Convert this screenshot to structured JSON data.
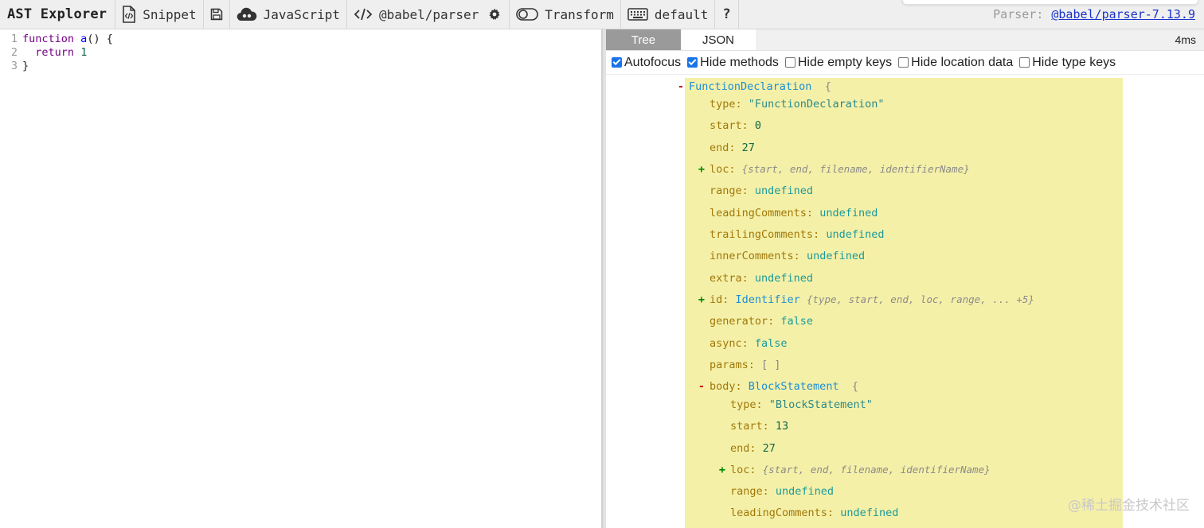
{
  "toolbar": {
    "brand": "AST Explorer",
    "snippet": "Snippet",
    "language": "JavaScript",
    "parser": "@babel/parser",
    "transform": "Transform",
    "keymap": "default",
    "help": "?",
    "parser_label": "Parser:",
    "parser_version": "@babel/parser-7.13.9"
  },
  "editor": {
    "lines": [
      {
        "num": "1",
        "parts": [
          [
            "kw",
            "function"
          ],
          [
            "plain",
            " "
          ],
          [
            "fn",
            "a"
          ],
          [
            "plain",
            "() {"
          ]
        ]
      },
      {
        "num": "2",
        "parts": [
          [
            "plain",
            "  "
          ],
          [
            "kw",
            "return"
          ],
          [
            "plain",
            " "
          ],
          [
            "num",
            "1"
          ]
        ]
      },
      {
        "num": "3",
        "parts": [
          [
            "plain",
            "}"
          ]
        ]
      }
    ]
  },
  "output": {
    "tabs": [
      "Tree",
      "JSON"
    ],
    "active_tab": "Tree",
    "timing": "4ms",
    "options": [
      {
        "label": "Autofocus",
        "checked": true
      },
      {
        "label": "Hide methods",
        "checked": true
      },
      {
        "label": "Hide empty keys",
        "checked": false
      },
      {
        "label": "Hide location data",
        "checked": false
      },
      {
        "label": "Hide type keys",
        "checked": false
      }
    ]
  },
  "tree": [
    {
      "depth": 0,
      "toggle": "-",
      "key": "",
      "type_name": "FunctionDeclaration",
      "open_brace": "{"
    },
    {
      "depth": 1,
      "key": "type",
      "value": "\"FunctionDeclaration\"",
      "kind": "str"
    },
    {
      "depth": 1,
      "key": "start",
      "value": "0",
      "kind": "num"
    },
    {
      "depth": 1,
      "key": "end",
      "value": "27",
      "kind": "num"
    },
    {
      "depth": 1,
      "toggle": "+",
      "key": "loc",
      "summary": "{start, end, filename, identifierName}"
    },
    {
      "depth": 1,
      "key": "range",
      "value": "undefined",
      "kind": "undef"
    },
    {
      "depth": 1,
      "key": "leadingComments",
      "value": "undefined",
      "kind": "undef"
    },
    {
      "depth": 1,
      "key": "trailingComments",
      "value": "undefined",
      "kind": "undef"
    },
    {
      "depth": 1,
      "key": "innerComments",
      "value": "undefined",
      "kind": "undef"
    },
    {
      "depth": 1,
      "key": "extra",
      "value": "undefined",
      "kind": "undef"
    },
    {
      "depth": 1,
      "toggle": "+",
      "key": "id",
      "type_name": "Identifier",
      "summary": "{type, start, end, loc, range, ... +5}"
    },
    {
      "depth": 1,
      "key": "generator",
      "value": "false",
      "kind": "bool"
    },
    {
      "depth": 1,
      "key": "async",
      "value": "false",
      "kind": "bool"
    },
    {
      "depth": 1,
      "key": "params",
      "value": "[ ]",
      "kind": "brace"
    },
    {
      "depth": 1,
      "toggle": "-",
      "key": "body",
      "type_name": "BlockStatement",
      "open_brace": "{"
    },
    {
      "depth": 2,
      "key": "type",
      "value": "\"BlockStatement\"",
      "kind": "str"
    },
    {
      "depth": 2,
      "key": "start",
      "value": "13",
      "kind": "num"
    },
    {
      "depth": 2,
      "key": "end",
      "value": "27",
      "kind": "num"
    },
    {
      "depth": 2,
      "toggle": "+",
      "key": "loc",
      "summary": "{start, end, filename, identifierName}"
    },
    {
      "depth": 2,
      "key": "range",
      "value": "undefined",
      "kind": "undef"
    },
    {
      "depth": 2,
      "key": "leadingComments",
      "value": "undefined",
      "kind": "undef"
    }
  ],
  "watermark": "@稀土掘金技术社区"
}
